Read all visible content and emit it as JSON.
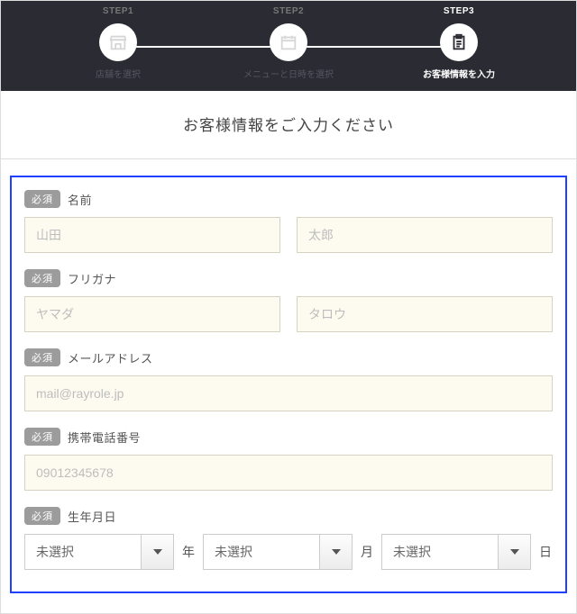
{
  "stepper": {
    "steps": [
      {
        "top": "STEP1",
        "bottom": "店舗を選択"
      },
      {
        "top": "STEP2",
        "bottom": "メニューと日時を選択"
      },
      {
        "top": "STEP3",
        "bottom": "お客様情報を入力"
      }
    ]
  },
  "card": {
    "title": "お客様情報をご入力ください"
  },
  "badge": "必須",
  "fields": {
    "name": {
      "label": "名前",
      "last_ph": "山田",
      "first_ph": "太郎"
    },
    "kana": {
      "label": "フリガナ",
      "last_ph": "ヤマダ",
      "first_ph": "タロウ"
    },
    "email": {
      "label": "メールアドレス",
      "ph": "mail@rayrole.jp"
    },
    "phone": {
      "label": "携帯電話番号",
      "ph": "09012345678"
    },
    "dob": {
      "label": "生年月日",
      "year_value": "未選択",
      "month_value": "未選択",
      "day_value": "未選択",
      "year_unit": "年",
      "month_unit": "月",
      "day_unit": "日"
    }
  }
}
